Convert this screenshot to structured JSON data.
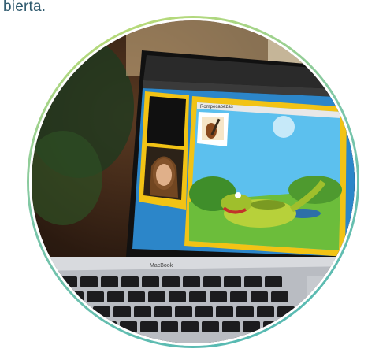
{
  "caption": "bierta.",
  "colors": {
    "ring_start": "#c9e06a",
    "ring_end": "#4fb7b5",
    "slide_frame": "#f2c315",
    "slide_bg": "#4fb6e8",
    "meet_sidebar": "#f2c315"
  },
  "scene": {
    "laptop_logo": "MacBook",
    "video_tiles": [
      "webcam-empty",
      "webcam-woman"
    ],
    "slide_title": "Rompecabezas",
    "slide_thumb": "guitar-and-violin-picture",
    "slide_character": "cartoon-crocodile"
  }
}
